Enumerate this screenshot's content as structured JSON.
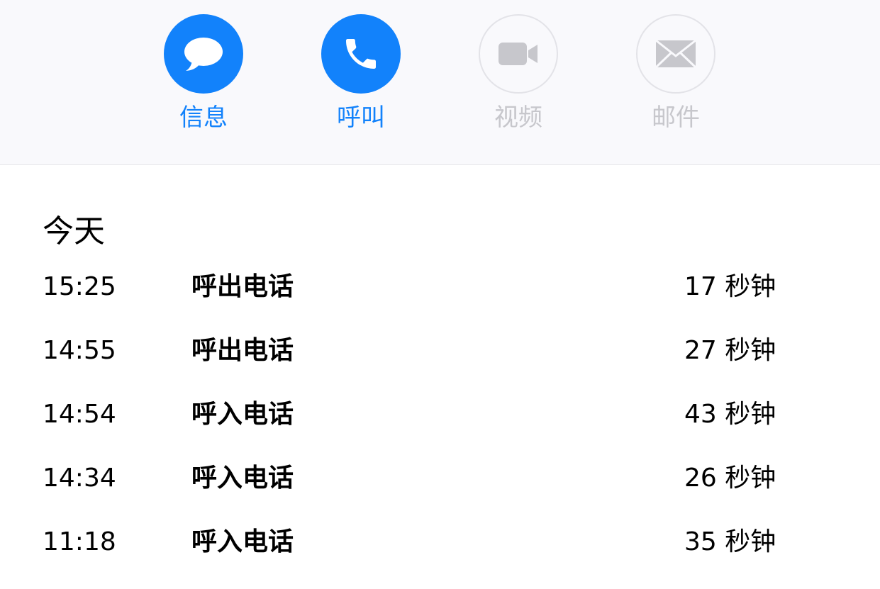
{
  "actions": [
    {
      "label": "信息",
      "icon": "message-bubble-icon",
      "state": "active"
    },
    {
      "label": "呼叫",
      "icon": "phone-icon",
      "state": "active"
    },
    {
      "label": "视频",
      "icon": "video-camera-icon",
      "state": "disabled"
    },
    {
      "label": "邮件",
      "icon": "mail-envelope-icon",
      "state": "disabled"
    }
  ],
  "colors": {
    "accent": "#1282fb",
    "disabled": "#c7c7cc",
    "header_bg": "#f9f9fc"
  },
  "call_history": {
    "section_title": "今天",
    "rows": [
      {
        "time": "15:25",
        "type": "呼出电话",
        "duration": "17 秒钟"
      },
      {
        "time": "14:55",
        "type": "呼出电话",
        "duration": "27 秒钟"
      },
      {
        "time": "14:54",
        "type": "呼入电话",
        "duration": "43 秒钟"
      },
      {
        "time": "14:34",
        "type": "呼入电话",
        "duration": "26 秒钟"
      },
      {
        "time": "11:18",
        "type": "呼入电话",
        "duration": "35 秒钟"
      }
    ]
  }
}
